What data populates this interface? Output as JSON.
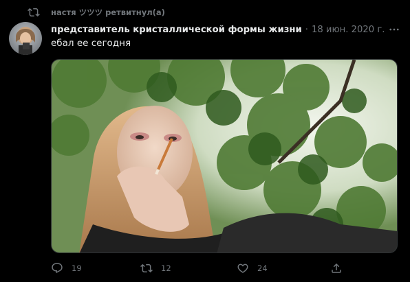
{
  "retweet": {
    "text": "настя ツツツ ретвитнул(а)"
  },
  "tweet": {
    "display_name": "представитель кристаллической формы жизни",
    "separator": "·",
    "date": "18 июн. 2020 г.",
    "text": "ебал ее сегодня",
    "media_alt": "photo",
    "avatar_alt": "avatar"
  },
  "actions": {
    "reply_count": "19",
    "retweet_count": "12",
    "like_count": "24",
    "share_label": ""
  },
  "colors": {
    "background": "#000000",
    "primary_text": "#e7e9ea",
    "secondary_text": "#71767b",
    "border": "#2f3336"
  },
  "icons": {
    "retweet": "retweet-icon",
    "more": "more-icon",
    "reply": "reply-icon",
    "like": "heart-icon",
    "share": "share-icon"
  }
}
